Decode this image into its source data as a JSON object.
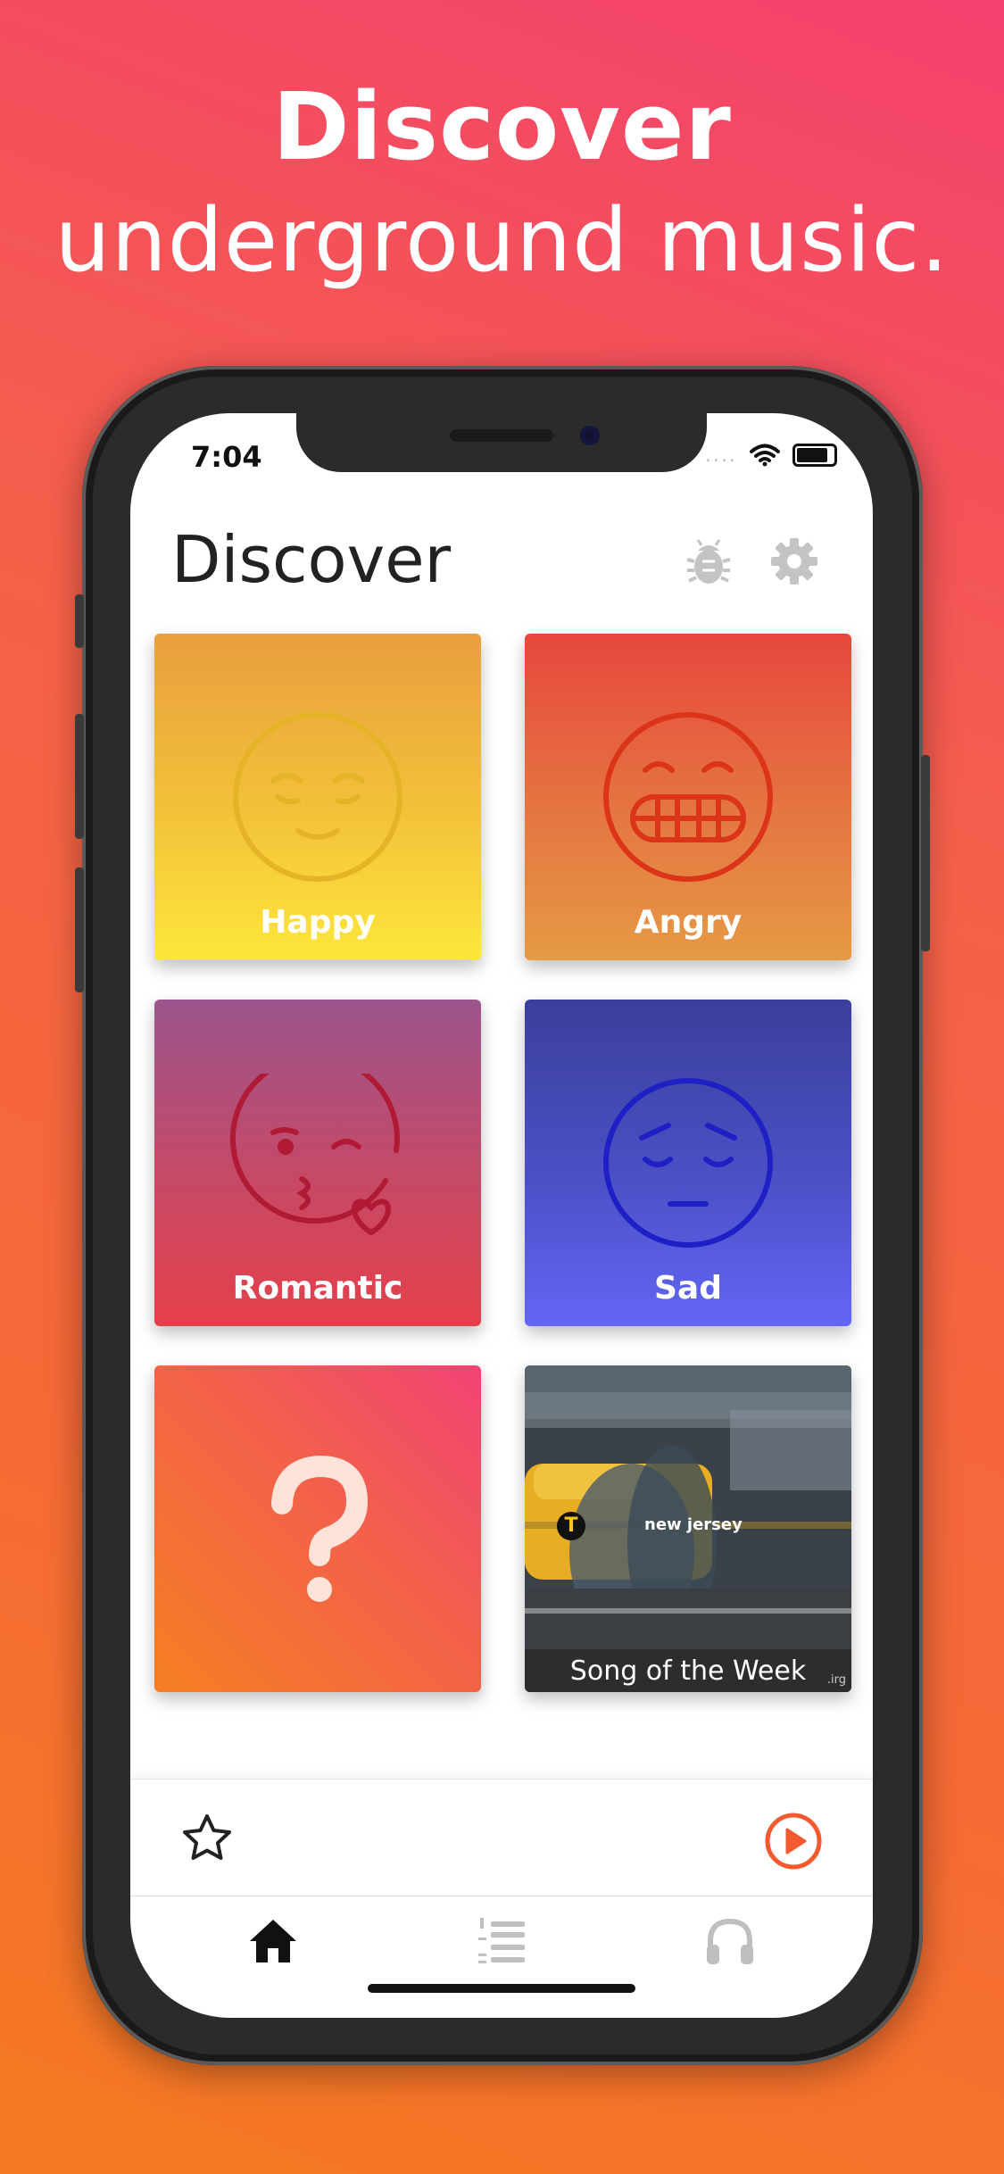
{
  "marketing": {
    "headline": "Discover",
    "subheadline": "underground music."
  },
  "status_bar": {
    "time": "7:04",
    "signal": "....",
    "wifi_icon": "wifi-icon",
    "battery_icon": "battery-icon"
  },
  "header": {
    "title": "Discover",
    "icons": [
      "bug-icon",
      "gear-icon"
    ]
  },
  "tiles": [
    {
      "label": "Happy",
      "icon": "smiling-face-icon",
      "colors": [
        "#e99e3e",
        "#fde63b"
      ]
    },
    {
      "label": "Angry",
      "icon": "grimacing-face-icon",
      "colors": [
        "#e6473d",
        "#e59a45"
      ]
    },
    {
      "label": "Romantic",
      "icon": "kissing-face-icon",
      "colors": [
        "#9c558d",
        "#e5404a"
      ]
    },
    {
      "label": "Sad",
      "icon": "pensive-face-icon",
      "colors": [
        "#3a3f9a",
        "#6266f4"
      ]
    },
    {
      "label": "",
      "icon": "question-mark-icon",
      "colors": [
        "#f57f22",
        "#f24375"
      ]
    },
    {
      "label": "Song of the Week",
      "icon": "song-of-week-image",
      "badge": "T",
      "sign": "new jersey",
      "watermark": ".irg"
    }
  ],
  "player": {
    "favorite_icon": "star-icon",
    "play_icon": "play-circle-icon",
    "accent": "#f4592f"
  },
  "tab_bar": {
    "items": [
      {
        "icon": "home-icon",
        "active": true
      },
      {
        "icon": "ranked-list-icon",
        "active": false
      },
      {
        "icon": "headphones-icon",
        "active": false
      }
    ]
  }
}
